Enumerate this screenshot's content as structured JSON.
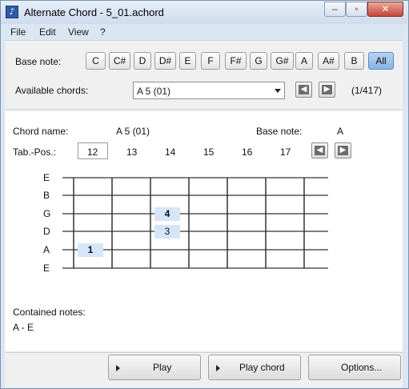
{
  "window": {
    "title": "Alternate Chord - 5_01.achord",
    "app_icon": "music-note-icon"
  },
  "menu": [
    "File",
    "Edit",
    "View",
    "?"
  ],
  "base_note_row": {
    "label": "Base note:",
    "notes": [
      "C",
      "C#",
      "D",
      "D#",
      "E",
      "F",
      "F#",
      "G",
      "G#",
      "A",
      "A#",
      "B",
      "All"
    ],
    "selected": "All"
  },
  "available_chords": {
    "label": "Available chords:",
    "value": "A 5 (01)",
    "counter": "(1/417)"
  },
  "chord_info": {
    "name_label": "Chord name:",
    "name_value": "A 5 (01)",
    "base_label": "Base note:",
    "base_value": "A",
    "tabpos_label": "Tab.-Pos.:",
    "positions": [
      "12",
      "13",
      "14",
      "15",
      "16",
      "17"
    ],
    "selected_position": "12"
  },
  "fretboard": {
    "strings": [
      "E",
      "B",
      "G",
      "D",
      "A",
      "E"
    ],
    "fingers": [
      {
        "string": "G",
        "fret": 3,
        "finger": "4"
      },
      {
        "string": "D",
        "fret": 3,
        "finger": "3"
      },
      {
        "string": "A",
        "fret": 1,
        "finger": "1"
      }
    ]
  },
  "contained_notes": {
    "label": "Contained notes:",
    "value": "A - E"
  },
  "footer": {
    "play_label": "Play",
    "play_chord_label": "Play chord",
    "options_label": "Options..."
  },
  "colors": {
    "accent": "#88b3e6",
    "finger_fill": "#d5e6f9",
    "frame": "#dbe6f3"
  }
}
